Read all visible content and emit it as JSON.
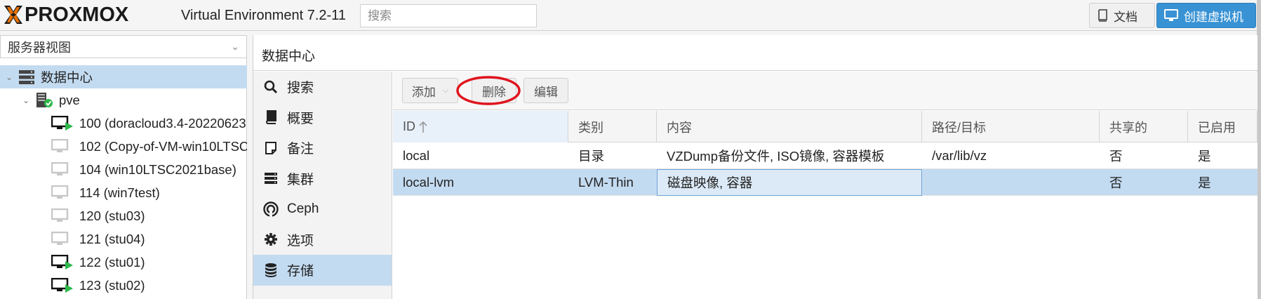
{
  "header": {
    "logo_text": "PROXMOX",
    "version": "Virtual Environment 7.2-11",
    "search_placeholder": "搜索",
    "docs_label": "文档",
    "create_vm_label": "创建虚拟机"
  },
  "left_panel": {
    "view_selector": "服务器视图",
    "tree": [
      {
        "label": "数据中心",
        "icon": "datacenter-icon",
        "selected": true
      },
      {
        "label": "pve",
        "icon": "node-online-icon"
      },
      {
        "label": "100 (doracloud3.4-20220623",
        "icon": "vm-running-icon"
      },
      {
        "label": "102 (Copy-of-VM-win10LTSC",
        "icon": "vm-stopped-icon"
      },
      {
        "label": "104 (win10LTSC2021base)",
        "icon": "vm-stopped-icon"
      },
      {
        "label": "114 (win7test)",
        "icon": "vm-stopped-icon"
      },
      {
        "label": "120 (stu03)",
        "icon": "vm-stopped-icon"
      },
      {
        "label": "121 (stu04)",
        "icon": "vm-stopped-icon"
      },
      {
        "label": "122 (stu01)",
        "icon": "vm-running-icon"
      },
      {
        "label": "123 (stu02)",
        "icon": "vm-running-icon"
      }
    ]
  },
  "content": {
    "title": "数据中心",
    "nav": [
      {
        "label": "搜索",
        "icon": "search-icon"
      },
      {
        "label": "概要",
        "icon": "book-icon"
      },
      {
        "label": "备注",
        "icon": "note-icon"
      },
      {
        "label": "集群",
        "icon": "cluster-icon"
      },
      {
        "label": "Ceph",
        "icon": "ceph-icon"
      },
      {
        "label": "选项",
        "icon": "gear-icon"
      },
      {
        "label": "存储",
        "icon": "database-icon",
        "selected": true
      }
    ],
    "toolbar": {
      "add_label": "添加",
      "remove_label": "删除",
      "edit_label": "编辑"
    },
    "table": {
      "columns": [
        "ID",
        "类别",
        "内容",
        "路径/目标",
        "共享的",
        "已启用"
      ],
      "rows": [
        [
          "local",
          "目录",
          "VZDump备份文件, ISO镜像, 容器模板",
          "/var/lib/vz",
          "否",
          "是"
        ],
        [
          "local-lvm",
          "LVM-Thin",
          "磁盘映像, 容器",
          "",
          "否",
          "是"
        ]
      ]
    }
  },
  "colors": {
    "accent": "#3892d4",
    "selection": "#c3dbf1",
    "logo_orange": "#e57000",
    "annotation_red": "#e0141e",
    "running_green": "#2db84a"
  }
}
